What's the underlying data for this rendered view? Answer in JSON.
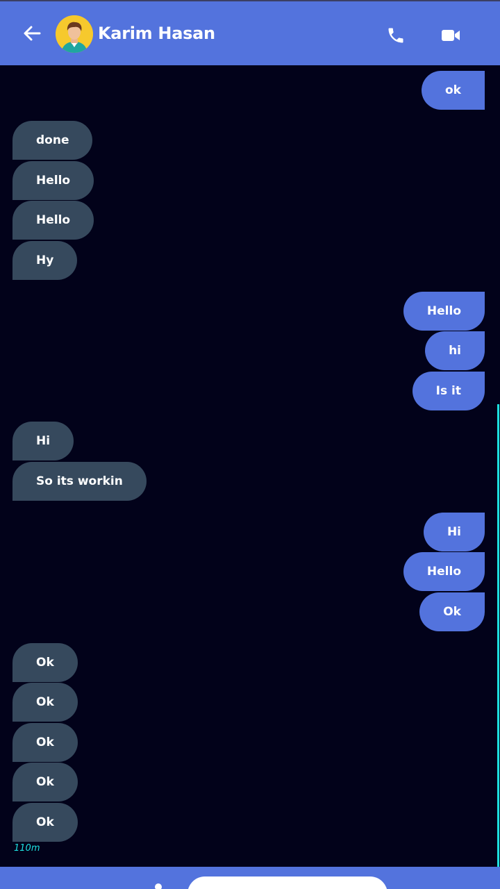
{
  "header": {
    "contact_name": "Karim Hasan",
    "back_icon": "arrow-left-icon",
    "call_icon": "phone-icon",
    "video_icon": "video-camera-icon",
    "avatar": "person-avatar"
  },
  "colors": {
    "background": "#02021a",
    "accent": "#5373dd",
    "incoming_bubble": "#36495d",
    "timestamp": "#1de0e0"
  },
  "messages": [
    {
      "text": "ok",
      "side": "out"
    },
    {
      "text": "done",
      "side": "in"
    },
    {
      "text": "Hello",
      "side": "in"
    },
    {
      "text": "Hello",
      "side": "in"
    },
    {
      "text": "Hy",
      "side": "in"
    },
    {
      "text": "Hello",
      "side": "out"
    },
    {
      "text": "hi",
      "side": "out"
    },
    {
      "text": "Is it",
      "side": "out"
    },
    {
      "text": "Hi",
      "side": "in"
    },
    {
      "text": "So its workin",
      "side": "in"
    },
    {
      "text": "Hi",
      "side": "out"
    },
    {
      "text": "Hello",
      "side": "out"
    },
    {
      "text": "Ok",
      "side": "out"
    },
    {
      "text": "Ok",
      "side": "in"
    },
    {
      "text": "Ok",
      "side": "in"
    },
    {
      "text": "Ok",
      "side": "in"
    },
    {
      "text": "Ok",
      "side": "in"
    },
    {
      "text": "Ok",
      "side": "in"
    }
  ],
  "last_message_time": "110m",
  "composer": {
    "placeholder": ""
  }
}
